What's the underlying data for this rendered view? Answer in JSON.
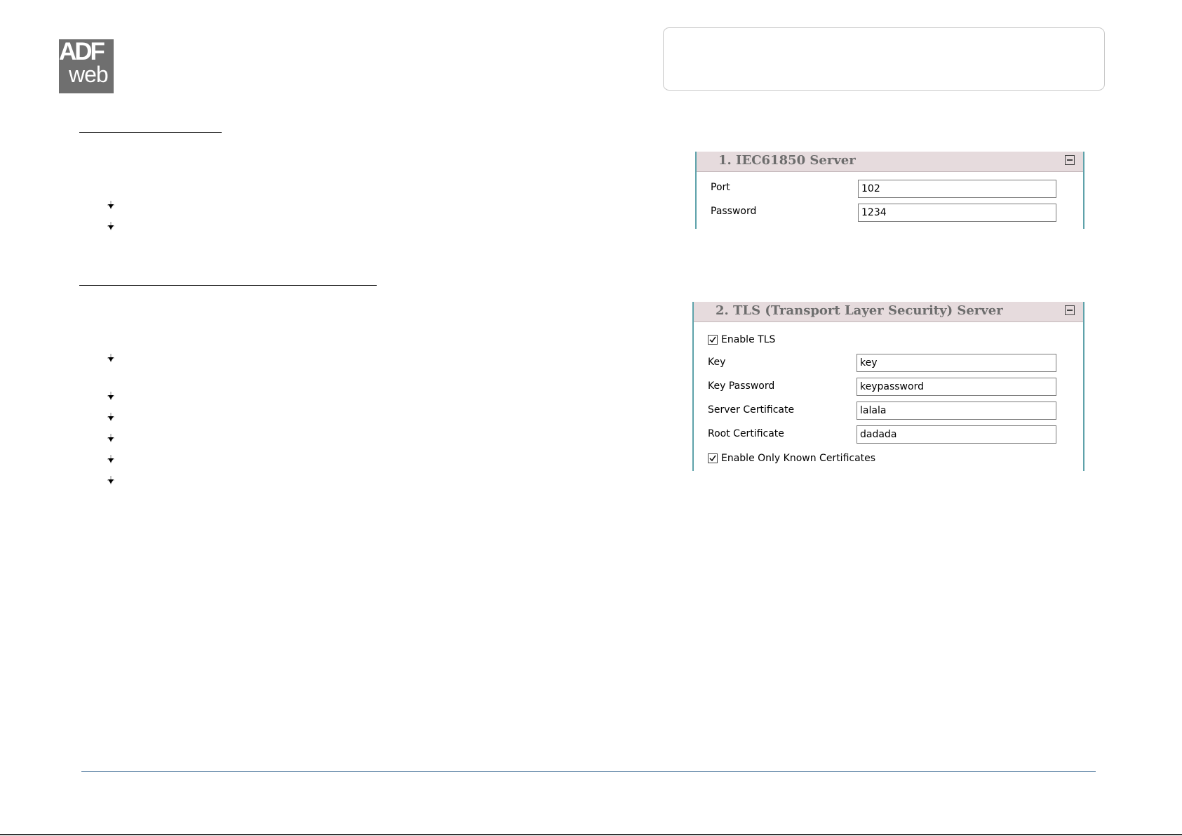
{
  "logo": {
    "line1": "ADF",
    "line2": "web"
  },
  "panel1": {
    "title": "1. IEC61850 Server",
    "fields": [
      {
        "label": "Port",
        "value": "102"
      },
      {
        "label": "Password",
        "value": "1234"
      }
    ]
  },
  "panel2": {
    "title": "2. TLS (Transport Layer Security) Server",
    "enable_tls": {
      "label": "Enable TLS",
      "checked": true
    },
    "fields": [
      {
        "label": "Key",
        "value": "key"
      },
      {
        "label": "Key Password",
        "value": "keypassword"
      },
      {
        "label": "Server Certificate",
        "value": "lalala"
      },
      {
        "label": "Root Certificate",
        "value": "dadada"
      }
    ],
    "enable_known": {
      "label": "Enable Only Known Certificates",
      "checked": true
    }
  },
  "icons": {
    "bullet": "arrow-bullet-icon",
    "collapse": "collapse-minus-icon",
    "check": "checkmark-icon"
  },
  "colors": {
    "panel_border": "#5ea2aa",
    "panel_header": "#e6dbdd",
    "footer_rule": "#2e5f8a",
    "logo_bg": "#6f6f6f"
  }
}
